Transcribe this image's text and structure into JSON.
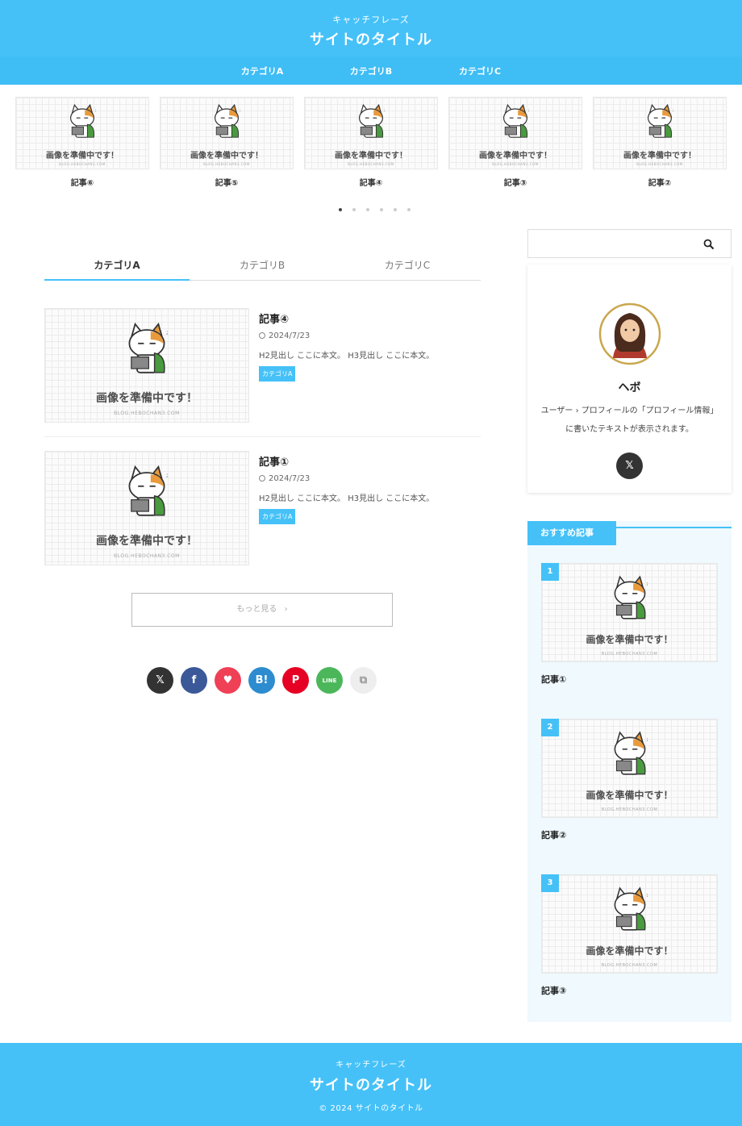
{
  "header": {
    "catchphrase": "キャッチフレーズ",
    "title": "サイトのタイトル",
    "nav": [
      "カテゴリA",
      "カテゴリB",
      "カテゴリC"
    ]
  },
  "placeholder": {
    "text": "画像を準備中です！",
    "url": "BLOG.HEBOCHAN3.COM"
  },
  "slider": {
    "items": [
      {
        "title": "記事⑥"
      },
      {
        "title": "記事⑤"
      },
      {
        "title": "記事④"
      },
      {
        "title": "記事③"
      },
      {
        "title": "記事②"
      }
    ],
    "dot_count": 6,
    "active_dot": 1
  },
  "tabs": [
    "カテゴリA",
    "カテゴリB",
    "カテゴリC"
  ],
  "posts": [
    {
      "title": "記事④",
      "date": "2024/7/23",
      "excerpt": "H2見出し ここに本文。 H3見出し ここに本文。",
      "category": "カテゴリA"
    },
    {
      "title": "記事①",
      "date": "2024/7/23",
      "excerpt": "H2見出し ここに本文。 H3見出し ここに本文。",
      "category": "カテゴリA"
    }
  ],
  "more_button": "もっと見る",
  "share_buttons": [
    {
      "icon": "x-icon",
      "label": "𝕏",
      "color": "#333333"
    },
    {
      "icon": "facebook-icon",
      "label": "f",
      "color": "#3b5998"
    },
    {
      "icon": "pocket-icon",
      "label": "♥",
      "color": "#ef4056"
    },
    {
      "icon": "hatena-bookmark-icon",
      "label": "B!",
      "color": "#2c8ccf"
    },
    {
      "icon": "pinterest-icon",
      "label": "P",
      "color": "#e60023"
    },
    {
      "icon": "line-icon",
      "label": "LINE",
      "color": "#4cb75a"
    },
    {
      "icon": "copy-icon",
      "label": "⧉",
      "color": "#eeeeee"
    }
  ],
  "sidebar": {
    "search": {
      "placeholder": ""
    },
    "profile": {
      "name": "ヘボ",
      "description": "ユーザー › プロフィールの「プロフィール情報」に書いたテキストが表示されます。"
    },
    "recommended": {
      "heading": "おすすめ記事",
      "items": [
        {
          "rank": "1",
          "title": "記事①"
        },
        {
          "rank": "2",
          "title": "記事②"
        },
        {
          "rank": "3",
          "title": "記事③"
        }
      ]
    }
  },
  "footer": {
    "catchphrase": "キャッチフレーズ",
    "title": "サイトのタイトル",
    "copyright": "© 2024 サイトのタイトル"
  },
  "colors": {
    "accent": "#45c1f8",
    "reco_bg": "#eff9fe"
  }
}
